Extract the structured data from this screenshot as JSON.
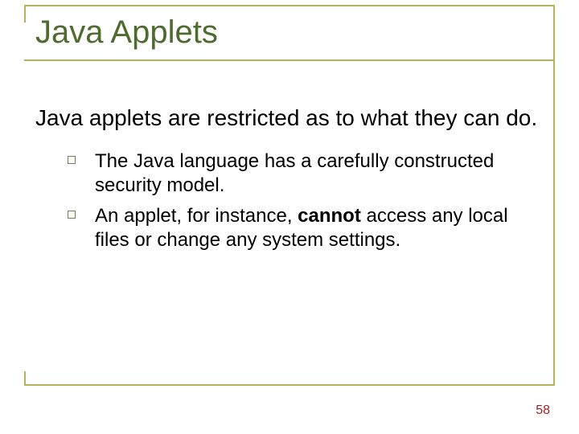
{
  "title": "Java Applets",
  "lead": "Java applets are restricted as to what they can do.",
  "bullets": [
    {
      "text": "The Java language has a carefully constructed security model."
    },
    {
      "prefix": "An applet, for instance, ",
      "bold": "cannot",
      "suffix": " access any local files or change any system settings."
    }
  ],
  "page_number": "58"
}
